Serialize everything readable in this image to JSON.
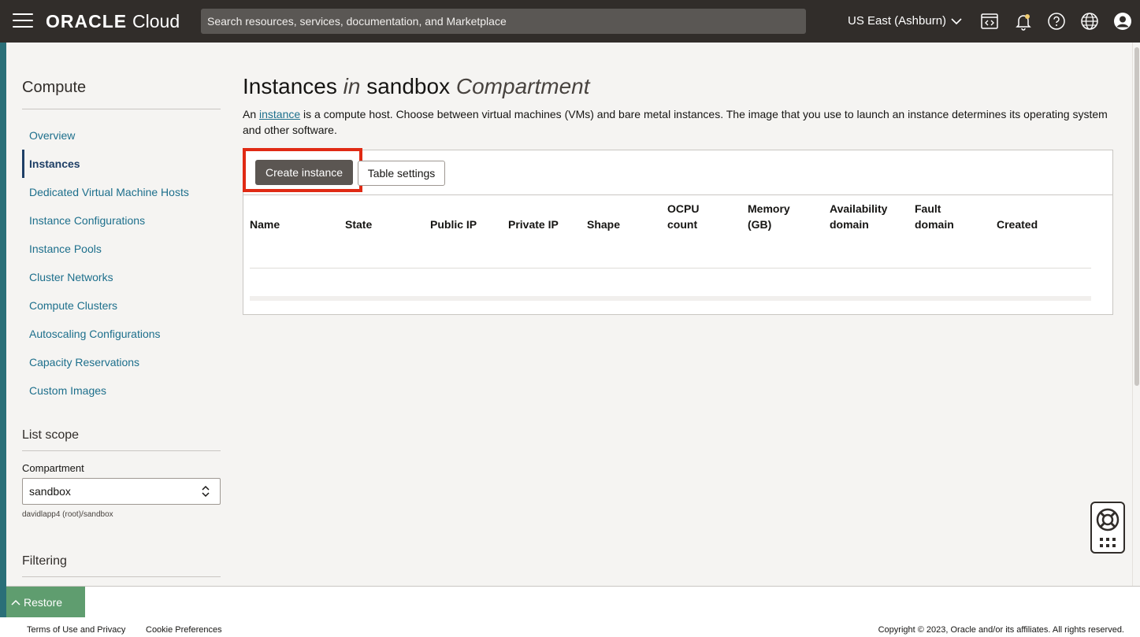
{
  "header": {
    "logo_brand": "ORACLE",
    "logo_product": "Cloud",
    "search_placeholder": "Search resources, services, documentation, and Marketplace",
    "region": "US East (Ashburn)"
  },
  "sidebar": {
    "title": "Compute",
    "items": [
      {
        "label": "Overview"
      },
      {
        "label": "Instances"
      },
      {
        "label": "Dedicated Virtual Machine Hosts"
      },
      {
        "label": "Instance Configurations"
      },
      {
        "label": "Instance Pools"
      },
      {
        "label": "Cluster Networks"
      },
      {
        "label": "Compute Clusters"
      },
      {
        "label": "Autoscaling Configurations"
      },
      {
        "label": "Capacity Reservations"
      },
      {
        "label": "Custom Images"
      }
    ],
    "active_index": 1,
    "list_scope_title": "List scope",
    "compartment_label": "Compartment",
    "compartment_value": "sandbox",
    "compartment_path": "davidlapp4 (root)/sandbox",
    "filtering_title": "Filtering"
  },
  "main": {
    "title_prefix": "Instances",
    "title_in": "in",
    "title_name": "sandbox",
    "title_suffix": "Compartment",
    "desc_before": "An ",
    "desc_link": "instance",
    "desc_after": " is a compute host. Choose between virtual machines (VMs) and bare metal instances. The image that you use to launch an instance determines its operating system and other software.",
    "create_button": "Create instance",
    "table_settings_button": "Table settings",
    "columns": [
      {
        "line1": "Name",
        "line2": ""
      },
      {
        "line1": "State",
        "line2": ""
      },
      {
        "line1": "Public IP",
        "line2": ""
      },
      {
        "line1": "Private IP",
        "line2": ""
      },
      {
        "line1": "Shape",
        "line2": ""
      },
      {
        "line1": "OCPU",
        "line2": "count"
      },
      {
        "line1": "Memory",
        "line2": "(GB)"
      },
      {
        "line1": "Availability",
        "line2": "domain"
      },
      {
        "line1": "Fault",
        "line2": "domain"
      },
      {
        "line1": "Created",
        "line2": ""
      }
    ]
  },
  "bottom": {
    "restore_label": "Restore",
    "terms": "Terms of Use and Privacy",
    "cookies": "Cookie Preferences",
    "copyright": "Copyright © 2023, Oracle and/or its affiliates. All rights reserved."
  },
  "colors": {
    "topbar": "#312d2a",
    "link": "#1d6f8c",
    "highlight": "#e02a14",
    "restore": "#5f9d6f"
  }
}
